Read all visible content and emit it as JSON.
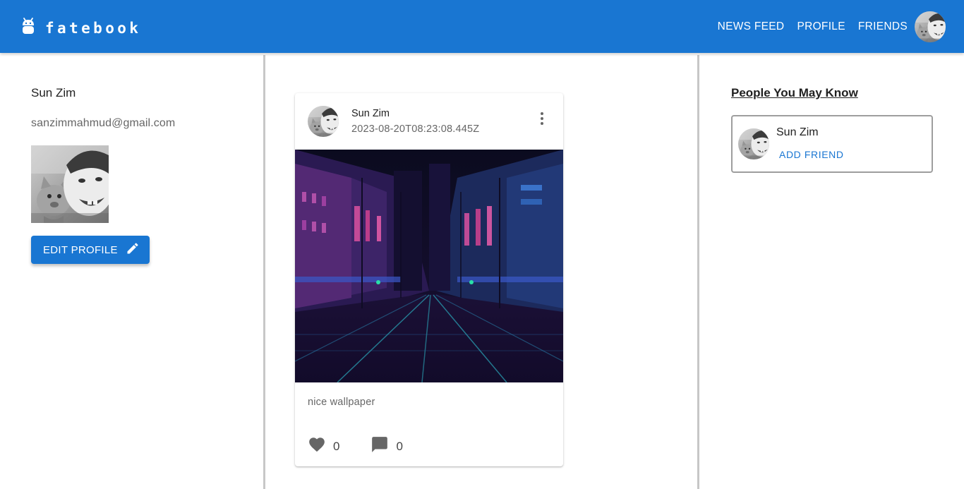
{
  "header": {
    "brand": "fatebook",
    "nav": [
      {
        "label": "NEWS FEED"
      },
      {
        "label": "PROFILE"
      },
      {
        "label": "FRIENDS"
      }
    ]
  },
  "profile": {
    "name": "Sun Zim",
    "email": "sanzimmahmud@gmail.com",
    "edit_label": "EDIT PROFILE"
  },
  "post": {
    "author": "Sun Zim",
    "timestamp": "2023-08-20T08:23:08.445Z",
    "caption": "nice wallpaper",
    "likes": "0",
    "comments": "0"
  },
  "suggestions": {
    "title": "People You May Know",
    "people": [
      {
        "name": "Sun Zim",
        "action": "ADD FRIEND"
      }
    ]
  },
  "colors": {
    "primary": "#1976d2",
    "divider": "#c7c7c7"
  },
  "icons": {
    "brand": "android-icon",
    "edit": "pencil-icon",
    "menu": "more-vert-icon",
    "like": "heart-icon",
    "comment": "comment-icon"
  }
}
